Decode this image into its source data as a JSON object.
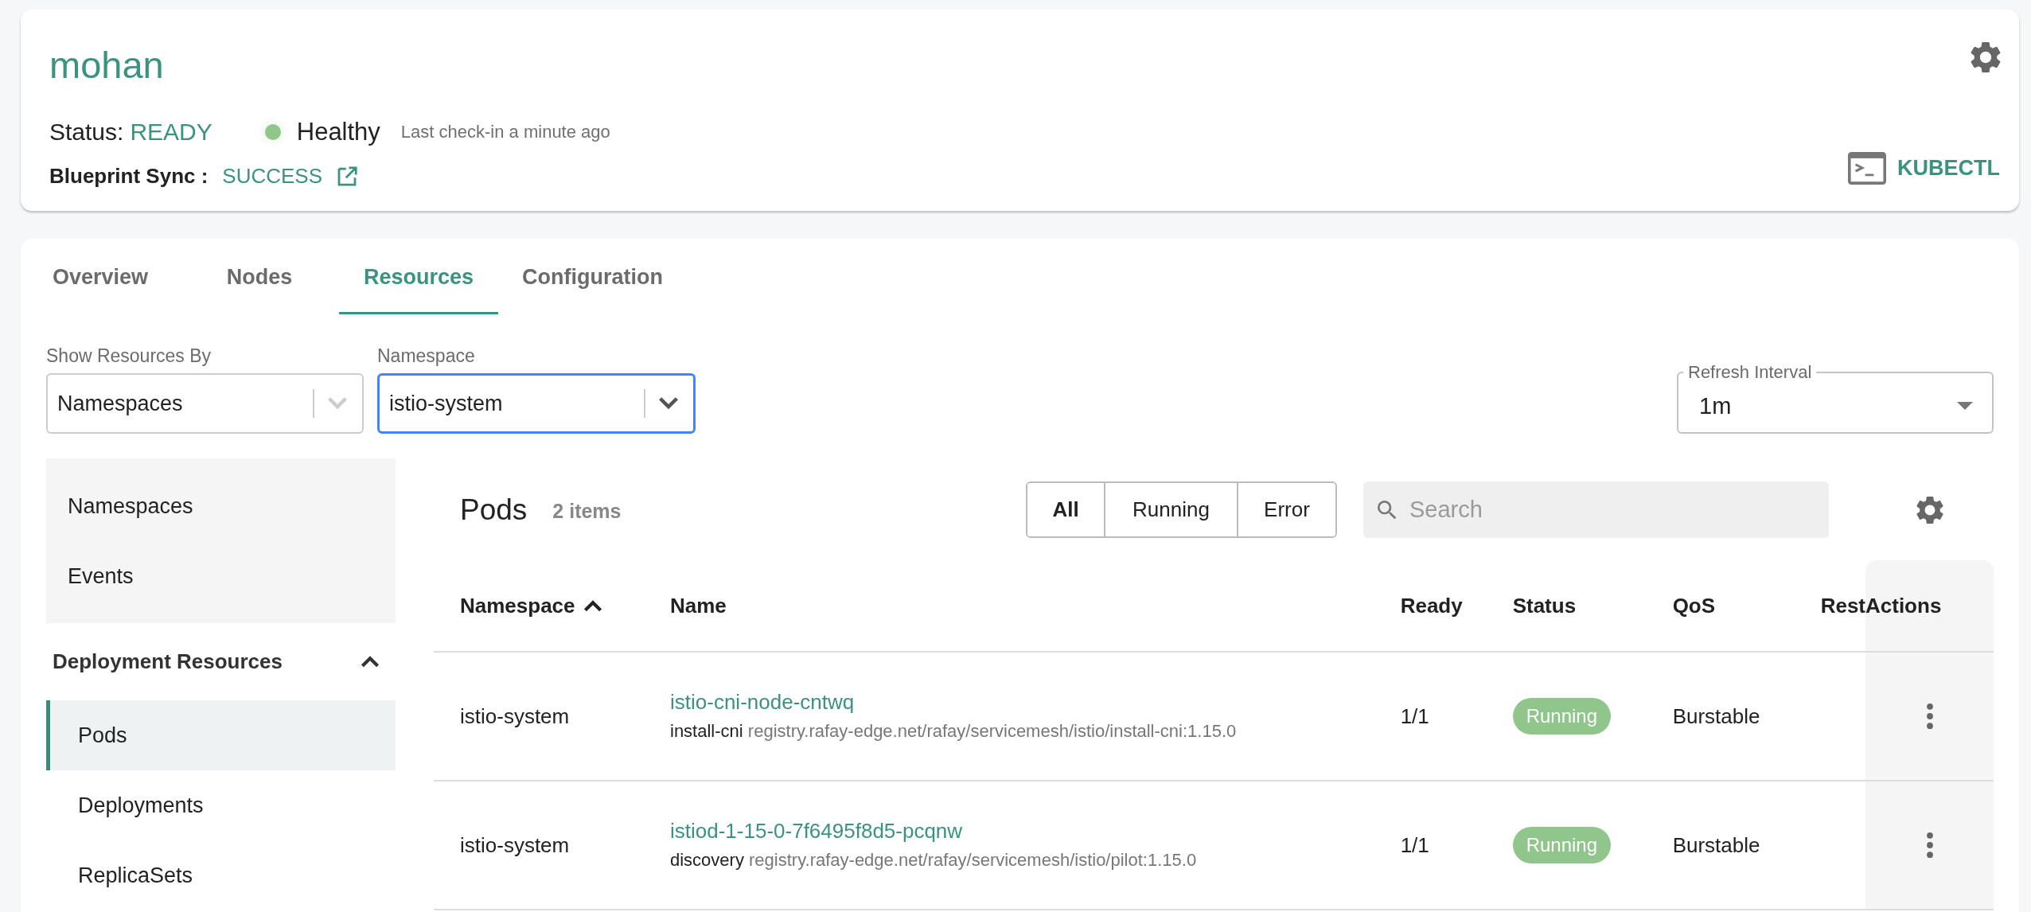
{
  "cluster": {
    "name": "mohan",
    "status_label": "Status:",
    "status": "READY",
    "health": {
      "label": "Healthy",
      "healthy": true
    },
    "last_checkin": "Last check-in a minute ago",
    "blueprint_label": "Blueprint Sync :",
    "blueprint_status": "SUCCESS",
    "kubectl": "KUBECTL"
  },
  "tabs": [
    {
      "label": "Overview",
      "selected": false
    },
    {
      "label": "Nodes",
      "selected": false
    },
    {
      "label": "Resources",
      "selected": true
    },
    {
      "label": "Configuration",
      "selected": false
    }
  ],
  "filters": {
    "show_by": {
      "label": "Show Resources By",
      "value": "Namespaces",
      "focused": false
    },
    "namespace": {
      "label": "Namespace",
      "value": "istio-system",
      "focused": true
    },
    "refresh": {
      "label": "Refresh Interval",
      "value": "1m"
    }
  },
  "sidebar": {
    "sections": [
      {
        "kind": "plain",
        "items": [
          {
            "label": "Namespaces",
            "selected": false
          },
          {
            "label": "Events",
            "selected": false
          }
        ]
      },
      {
        "kind": "group",
        "title": "Deployment Resources",
        "expanded": true,
        "items": [
          {
            "label": "Pods",
            "selected": true
          },
          {
            "label": "Deployments",
            "selected": false
          },
          {
            "label": "ReplicaSets",
            "selected": false
          }
        ]
      }
    ]
  },
  "pods": {
    "title": "Pods",
    "count": "2 items",
    "status_filters": [
      {
        "label": "All",
        "selected": true
      },
      {
        "label": "Running",
        "selected": false
      },
      {
        "label": "Error",
        "selected": false
      }
    ],
    "search": {
      "placeholder": "Search"
    },
    "table": {
      "columns": [
        {
          "label": "Namespace",
          "sorted": true
        },
        {
          "label": "Name",
          "sorted": false
        },
        {
          "label": "Ready",
          "sorted": false
        },
        {
          "label": "Status",
          "sorted": false
        },
        {
          "label": "QoS",
          "sorted": false
        },
        {
          "label": "Rest",
          "sorted": false
        },
        {
          "label": "Actions",
          "sorted": false
        }
      ],
      "rows": [
        {
          "namespace": "istio-system",
          "name": "istio-cni-node-cntwq",
          "container": "install-cni",
          "image": "registry.rafay-edge.net/rafay/servicemesh/istio/install-cni:1.15.0",
          "ready": "1/1",
          "status": "Running",
          "qos": "Burstable"
        },
        {
          "namespace": "istio-system",
          "name": "istiod-1-15-0-7f6495f8d5-pcqnw",
          "container": "discovery",
          "image": "registry.rafay-edge.net/rafay/servicemesh/istio/pilot:1.15.0",
          "ready": "1/1",
          "status": "Running",
          "qos": "Burstable"
        }
      ]
    }
  }
}
